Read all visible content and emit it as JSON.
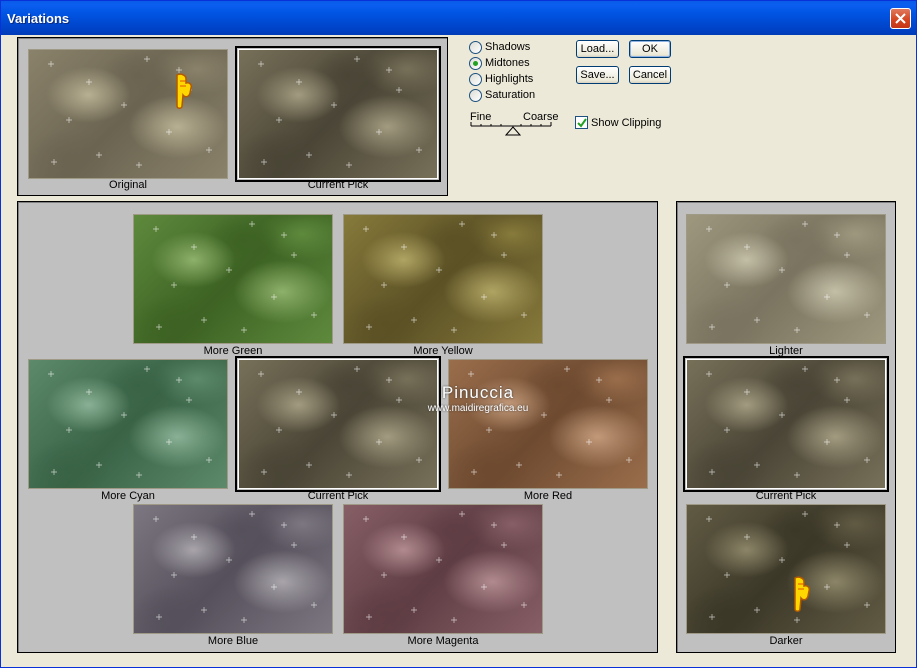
{
  "window": {
    "title": "Variations"
  },
  "tones": {
    "options": [
      "Shadows",
      "Midtones",
      "Highlights",
      "Saturation"
    ],
    "selected": "Midtones"
  },
  "slider": {
    "fine_label": "Fine",
    "coarse_label": "Coarse",
    "value": 0.5
  },
  "buttons": {
    "load": "Load...",
    "ok": "OK",
    "save": "Save...",
    "cancel": "Cancel"
  },
  "show_clipping": {
    "label": "Show Clipping",
    "checked": true
  },
  "previews": {
    "original": "Original",
    "current_pick": "Current Pick"
  },
  "color_variations": {
    "more_green": "More Green",
    "more_yellow": "More Yellow",
    "more_cyan": "More Cyan",
    "current_pick": "Current Pick",
    "more_red": "More Red",
    "more_blue": "More Blue",
    "more_magenta": "More Magenta"
  },
  "brightness": {
    "lighter": "Lighter",
    "current_pick": "Current Pick",
    "darker": "Darker"
  },
  "watermark": {
    "line1": "Pinuccia",
    "line2": "www.maidiregrafica.eu"
  },
  "colors": {
    "original": [
      "#b8b092",
      "#8a826a",
      "#6b6451"
    ],
    "current": [
      "#a29b80",
      "#777059",
      "#4a4536"
    ],
    "green": [
      "#8db06a",
      "#5e8a3d",
      "#3d6223"
    ],
    "yellow": [
      "#b0a463",
      "#877a3b",
      "#5b5125"
    ],
    "cyan": [
      "#89b094",
      "#5c8a6a",
      "#3a6346"
    ],
    "red": [
      "#c29a7a",
      "#9a6e4c",
      "#6e4a30"
    ],
    "blue": [
      "#a8a4aa",
      "#7c7781",
      "#55505b"
    ],
    "magenta": [
      "#b08a8e",
      "#875f66",
      "#5f3d44"
    ],
    "lighter": [
      "#c3bea6",
      "#9e987f",
      "#7a7460"
    ],
    "darker": [
      "#8c8568",
      "#615b44",
      "#3c3828"
    ]
  }
}
